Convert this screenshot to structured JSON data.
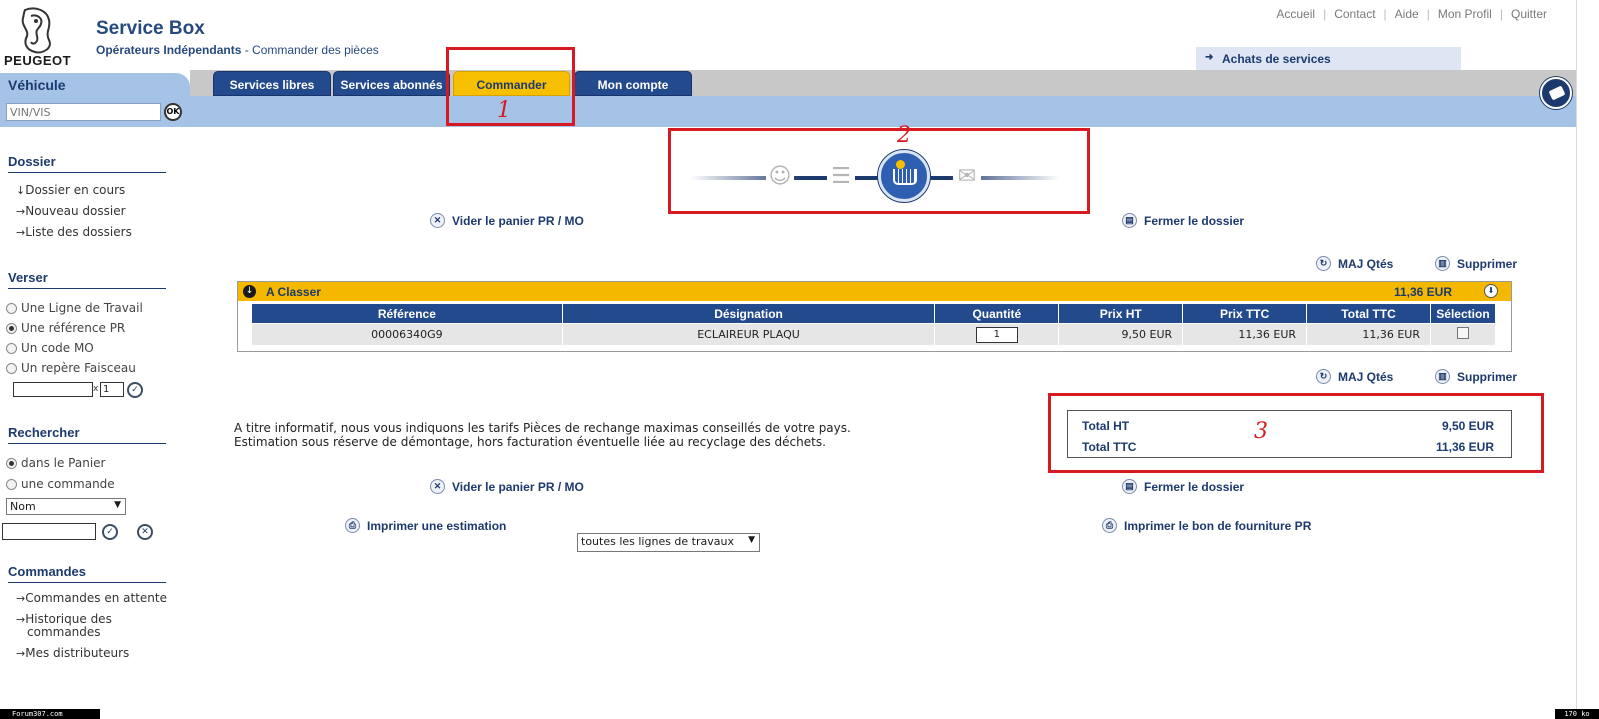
{
  "brand": {
    "logo_text": "PEUGEOT",
    "app_title": "Service Box",
    "subtitle_bold": "Opérateurs Indépendants",
    "subtitle_rest": " - Commander des pièces",
    "accent": "#234a8c",
    "highlight": "#f6bf00",
    "annotation_color": "#d71a21"
  },
  "top_links": [
    "Accueil",
    "Contact",
    "Aide",
    "Mon Profil",
    "Quitter"
  ],
  "top_link_separator": "|",
  "achats_label": "Achats de services",
  "nav": {
    "vehicule_label": "Véhicule",
    "tabs": [
      {
        "label": "Services libres",
        "active": false
      },
      {
        "label": "Services abonnés",
        "active": false
      },
      {
        "label": "Commander",
        "active": true
      },
      {
        "label": "Mon compte",
        "active": false
      }
    ],
    "vin_placeholder": "VIN/VIS",
    "ok_label": "OK"
  },
  "sidebar": {
    "dossier": {
      "title": "Dossier",
      "links": [
        "Dossier en cours",
        "Nouveau dossier",
        "Liste des dossiers"
      ]
    },
    "verser": {
      "title": "Verser",
      "options": [
        {
          "label": "Une Ligne de Travail",
          "checked": false
        },
        {
          "label": "Une référence PR",
          "checked": true
        },
        {
          "label": "Un code MO",
          "checked": false
        },
        {
          "label": "Un repère Faisceau",
          "checked": false
        }
      ],
      "qty_value": "1",
      "qty_separator": "x"
    },
    "rechercher": {
      "title": "Rechercher",
      "options": [
        {
          "label": "dans le Panier",
          "checked": true
        },
        {
          "label": "une commande",
          "checked": false
        }
      ],
      "select_value": "Nom"
    },
    "commandes": {
      "title": "Commandes",
      "links": [
        "Commandes en attente",
        "Historique des commandes",
        "Mes distributeurs"
      ]
    }
  },
  "actions": {
    "vider": "Vider le panier PR / MO",
    "fermer": "Fermer le dossier",
    "maj": "MAJ Qtés",
    "supprimer": "Supprimer",
    "imprimer_estimation": "Imprimer une estimation",
    "lignes_select": "toutes les lignes de travaux",
    "imprimer_bon": "Imprimer le bon de fourniture PR"
  },
  "basket": {
    "title": "A Classer",
    "total": "11,36 EUR",
    "columns": [
      "Référence",
      "Désignation",
      "Quantité",
      "Prix HT",
      "Prix TTC",
      "Total TTC",
      "Sélection"
    ],
    "rows": [
      {
        "reference": "00006340G9",
        "designation": "ECLAIREUR PLAQU",
        "quantite": "1",
        "prix_ht": "9,50 EUR",
        "prix_ttc": "11,36 EUR",
        "total_ttc": "11,36 EUR",
        "selected": false
      }
    ]
  },
  "info_lines": [
    "A titre informatif, nous vous indiquons les tarifs Pièces de rechange maximas conseillés de votre pays.",
    "Estimation sous réserve de démontage, hors facturation éventuelle liée au recyclage des déchets."
  ],
  "totals": {
    "ht_label": "Total HT",
    "ht_value": "9,50  EUR",
    "ttc_label": "Total TTC",
    "ttc_value": "11,36  EUR"
  },
  "annotations": {
    "one": "1",
    "two": "2",
    "three": "3"
  },
  "footer": {
    "left": "Forum307.com",
    "right": "170 ko"
  },
  "icons": {
    "toggle": "arrow-down-icon",
    "step_user": "user-car-icon",
    "step_list": "checklist-icon",
    "step_basket": "basket-icon",
    "step_order": "order-icon"
  }
}
